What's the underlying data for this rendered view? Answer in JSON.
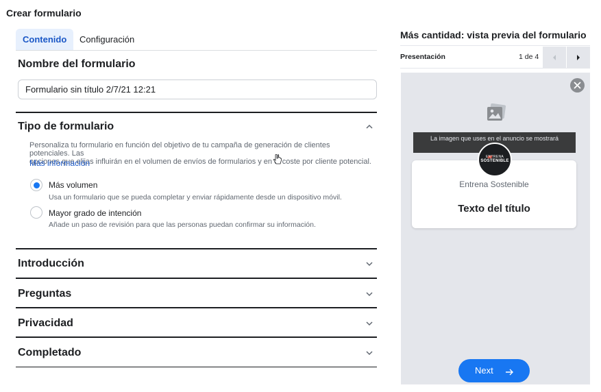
{
  "window": {
    "title": "Crear formulario"
  },
  "tabs": [
    {
      "label": "Contenido",
      "active": true
    },
    {
      "label": "Configuración",
      "active": false
    }
  ],
  "form_name": {
    "heading": "Nombre del formulario",
    "value": "Formulario sin título 2/7/21 12:21"
  },
  "form_type": {
    "heading": "Tipo de formulario",
    "description_line1": "Personaliza tu formulario en función del objetivo de tu campaña de generación de clientes potenciales. Las",
    "description_line2": "opciones que elijas influirán en el volumen de envíos de formularios y en el coste por cliente potencial.",
    "more_link": "Más información",
    "options": [
      {
        "label": "Más volumen",
        "sub": "Usa un formulario que se pueda completar y enviar rápidamente desde un dispositivo móvil.",
        "selected": true
      },
      {
        "label": "Mayor grado de intención",
        "sub": "Añade un paso de revisión para que las personas puedan confirmar su información.",
        "selected": false
      }
    ]
  },
  "sections": [
    {
      "label": "Introducción"
    },
    {
      "label": "Preguntas"
    },
    {
      "label": "Privacidad"
    },
    {
      "label": "Completado"
    }
  ],
  "preview": {
    "title": "Más cantidad: vista previa del formulario",
    "nav_label": "Presentación",
    "page_count": "1 de 4",
    "image_notice": "La imagen que uses en el anuncio se mostrará",
    "avatar_line1": "ENTRENA",
    "avatar_line2": "SOSTENIBLE",
    "company": "Entrena Sostenible",
    "headline": "Texto del título",
    "next_label": "Next"
  },
  "colors": {
    "accent": "#1877f2",
    "tab_active_bg": "#e7f0fd",
    "tab_active_text": "#1a57c6",
    "preview_bg": "#e4e6eb"
  }
}
